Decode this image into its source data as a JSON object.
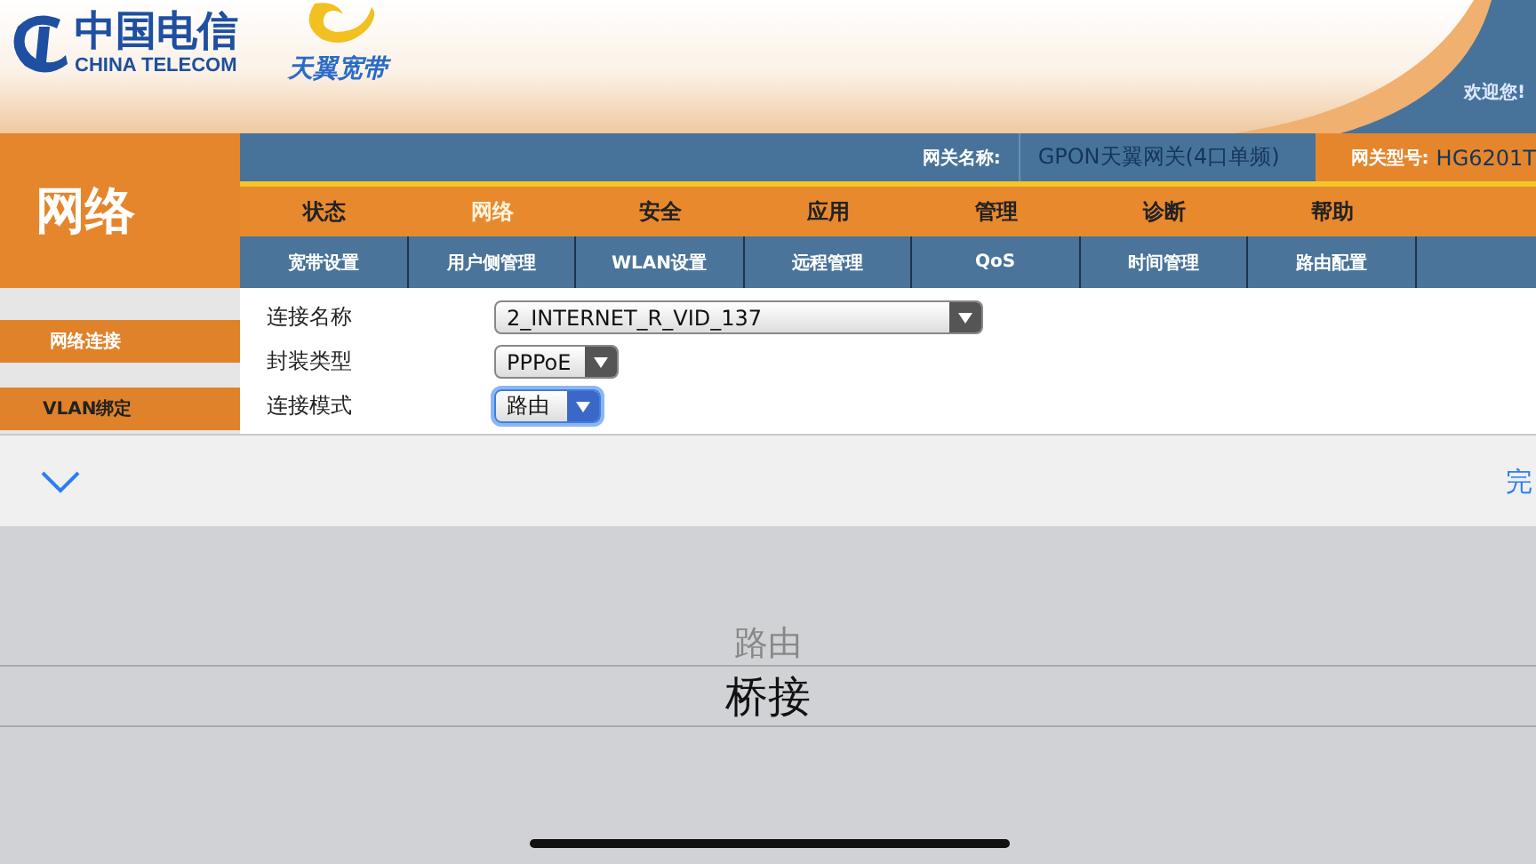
{
  "header": {
    "brand_cn": "中国电信",
    "brand_en": "CHINA TELECOM",
    "broadband": "天翼宽带",
    "welcome": "欢迎您!"
  },
  "info": {
    "name_label": "网关名称:",
    "name": "GPON天翼网关(4口单频)",
    "model_label": "网关型号:",
    "model": "HG6201T"
  },
  "section_title": "网络",
  "nav": [
    {
      "label": "状态",
      "selected": false
    },
    {
      "label": "网络",
      "selected": true
    },
    {
      "label": "安全",
      "selected": false
    },
    {
      "label": "应用",
      "selected": false
    },
    {
      "label": "管理",
      "selected": false
    },
    {
      "label": "诊断",
      "selected": false
    },
    {
      "label": "帮助",
      "selected": false
    }
  ],
  "subnav": [
    "宽带设置",
    "用户侧管理",
    "WLAN设置",
    "远程管理",
    "QoS",
    "时间管理",
    "路由配置"
  ],
  "sidebar": [
    {
      "label": "网络连接",
      "selected": true
    },
    {
      "label": "VLAN绑定",
      "selected": false
    }
  ],
  "form": [
    {
      "label": "连接名称",
      "value": "2_INTERNET_R_VID_137",
      "kind": "wide",
      "focused": false
    },
    {
      "label": "封装类型",
      "value": "PPPoE",
      "kind": "narrow",
      "focused": false
    },
    {
      "label": "连接模式",
      "value": "路由",
      "kind": "narrow",
      "focused": true
    }
  ],
  "picker": {
    "done": "完",
    "options": [
      {
        "label": "路由",
        "selected": false
      },
      {
        "label": "桥接",
        "selected": true
      }
    ]
  }
}
